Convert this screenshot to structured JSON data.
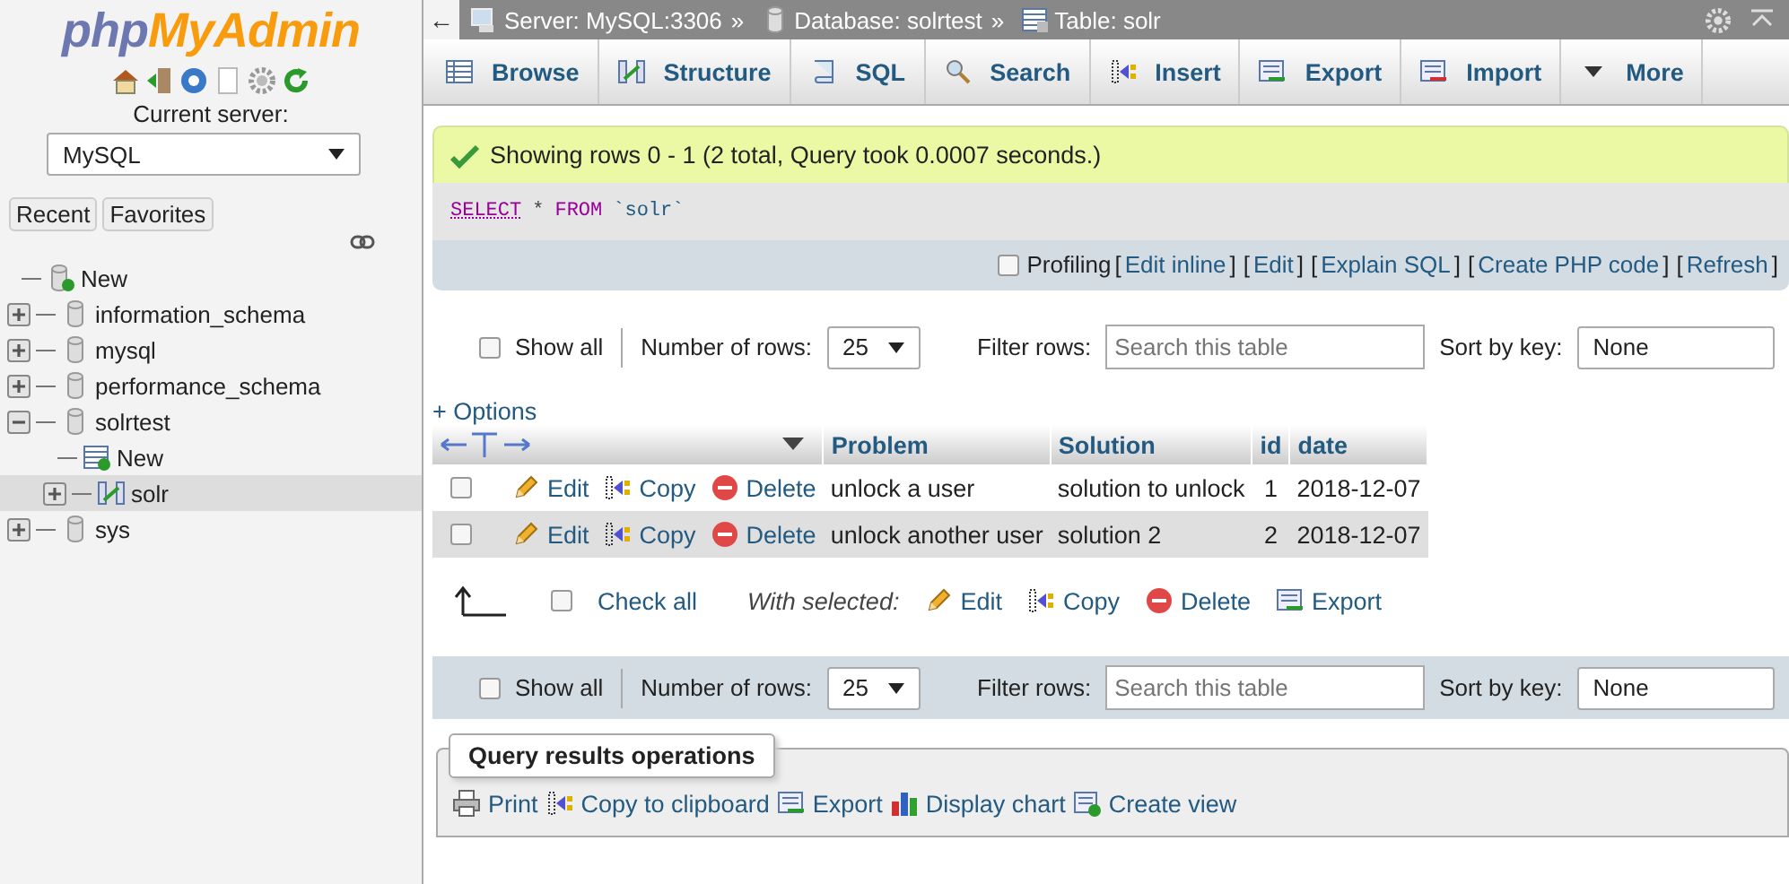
{
  "sidebar": {
    "logo": {
      "left": "php",
      "right": "MyAdmin"
    },
    "current_server_label": "Current server:",
    "server_select": "MySQL",
    "quick_tabs": [
      {
        "label": "Recent"
      },
      {
        "label": "Favorites"
      }
    ],
    "tree": [
      {
        "label": "New",
        "kind": "new-db",
        "selected": false
      },
      {
        "label": "information_schema",
        "kind": "db",
        "expanded": false,
        "selected": false
      },
      {
        "label": "mysql",
        "kind": "db",
        "expanded": false,
        "selected": false
      },
      {
        "label": "performance_schema",
        "kind": "db",
        "expanded": false,
        "selected": false
      },
      {
        "label": "solrtest",
        "kind": "db",
        "expanded": true,
        "selected": false,
        "children": [
          {
            "label": "New",
            "kind": "new-table",
            "selected": false
          },
          {
            "label": "solr",
            "kind": "table",
            "expanded": false,
            "selected": true
          }
        ]
      },
      {
        "label": "sys",
        "kind": "db",
        "expanded": false,
        "selected": false
      }
    ]
  },
  "back_arrow": "←",
  "breadcrumb": {
    "separator": "»",
    "items": [
      {
        "label": "Server: MySQL:3306",
        "kind": "server"
      },
      {
        "label": "Database: solrtest",
        "kind": "database"
      },
      {
        "label": "Table: solr",
        "kind": "table"
      }
    ]
  },
  "tabs": [
    {
      "label": "Browse",
      "kind": "browse",
      "selected": false
    },
    {
      "label": "Structure",
      "kind": "structure",
      "selected": false
    },
    {
      "label": "SQL",
      "kind": "sql",
      "selected": false
    },
    {
      "label": "Search",
      "kind": "search",
      "selected": false
    },
    {
      "label": "Insert",
      "kind": "insert",
      "selected": false
    },
    {
      "label": "Export",
      "kind": "export",
      "selected": false
    },
    {
      "label": "Import",
      "kind": "import",
      "selected": false
    },
    {
      "label": "More",
      "kind": "more",
      "selected": false
    }
  ],
  "message": "Showing rows 0 - 1 (2 total, Query took 0.0007 seconds.)",
  "sql": [
    {
      "text": "SELECT",
      "kind": "keyword-link"
    },
    {
      "text": "*",
      "kind": "plain"
    },
    {
      "text": "FROM",
      "kind": "keyword"
    },
    {
      "text": "`solr`",
      "kind": "identifier"
    }
  ],
  "profiling": {
    "label": "Profiling",
    "checked": false,
    "open": "[",
    "close": "]",
    "links": [
      "Edit inline",
      "Edit",
      "Explain SQL",
      "Create PHP code",
      "Refresh"
    ]
  },
  "nav_bars": [
    {
      "kind": "plain",
      "show_all": {
        "label": "Show all",
        "checked": false
      },
      "rows_label": "Number of rows:",
      "rows_value": "25",
      "filter_label": "Filter rows:",
      "filter_placeholder": "Search this table",
      "sort_label": "Sort by key:",
      "sort_value": "None"
    },
    {
      "kind": "shaded",
      "show_all": {
        "label": "Show all",
        "checked": false
      },
      "rows_label": "Number of rows:",
      "rows_value": "25",
      "filter_label": "Filter rows:",
      "filter_placeholder": "Search this table",
      "sort_label": "Sort by key:",
      "sort_value": "None"
    }
  ],
  "options_link": "+ Options",
  "table": {
    "columns": [
      "Problem",
      "Solution",
      "id",
      "date"
    ],
    "rows": [
      {
        "selected": false,
        "actions": [
          {
            "label": "Edit",
            "kind": "edit"
          },
          {
            "label": "Copy",
            "kind": "copy"
          },
          {
            "label": "Delete",
            "kind": "delete"
          }
        ],
        "cells": [
          "unlock a user",
          "solution to unlock",
          "1",
          "2018-12-07"
        ]
      },
      {
        "selected": false,
        "actions": [
          {
            "label": "Edit",
            "kind": "edit"
          },
          {
            "label": "Copy",
            "kind": "copy"
          },
          {
            "label": "Delete",
            "kind": "delete"
          }
        ],
        "cells": [
          "unlock another user",
          "solution 2",
          "2",
          "2018-12-07"
        ]
      }
    ]
  },
  "bulk": {
    "check_all": {
      "label": "Check all",
      "checked": false
    },
    "with_selected": "With selected:",
    "actions": [
      {
        "label": "Edit",
        "kind": "edit"
      },
      {
        "label": "Copy",
        "kind": "copy"
      },
      {
        "label": "Delete",
        "kind": "delete"
      },
      {
        "label": "Export",
        "kind": "export"
      }
    ]
  },
  "operations": {
    "title": "Query results operations",
    "items": [
      {
        "label": "Print",
        "kind": "print"
      },
      {
        "label": "Copy to clipboard",
        "kind": "copy"
      },
      {
        "label": "Export",
        "kind": "export"
      },
      {
        "label": "Display chart",
        "kind": "chart"
      },
      {
        "label": "Create view",
        "kind": "view"
      }
    ]
  }
}
